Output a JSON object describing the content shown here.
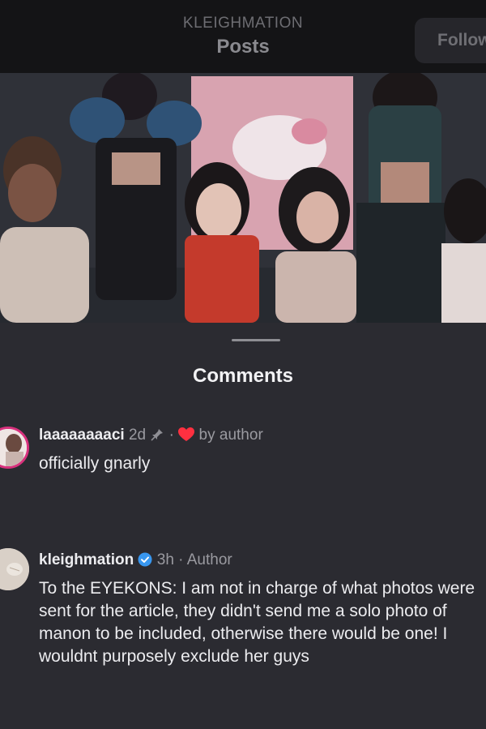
{
  "header": {
    "username": "KLEIGHMATION",
    "title": "Posts",
    "follow_label": "Follow"
  },
  "sheet": {
    "title": "Comments"
  },
  "comments": [
    {
      "username": "laaaaaaaaci",
      "time": "2d",
      "separator": "·",
      "liked_by": "by author",
      "text": "officially gnarly"
    },
    {
      "username": "kleighmation",
      "time": "3h",
      "separator": "·",
      "role": "Author",
      "text": "To the EYEKONS: I am not in charge of what photos were sent for the article, they didn't send me a solo photo of manon to be included, otherwise there would be one! I wouldnt purposely exclude her guys"
    }
  ],
  "colors": {
    "verified": "#3897f0",
    "heart": "#ff3040",
    "story_ring": "#d8317d"
  },
  "icons": [
    "pin-icon",
    "heart-icon",
    "verified-badge-icon"
  ]
}
